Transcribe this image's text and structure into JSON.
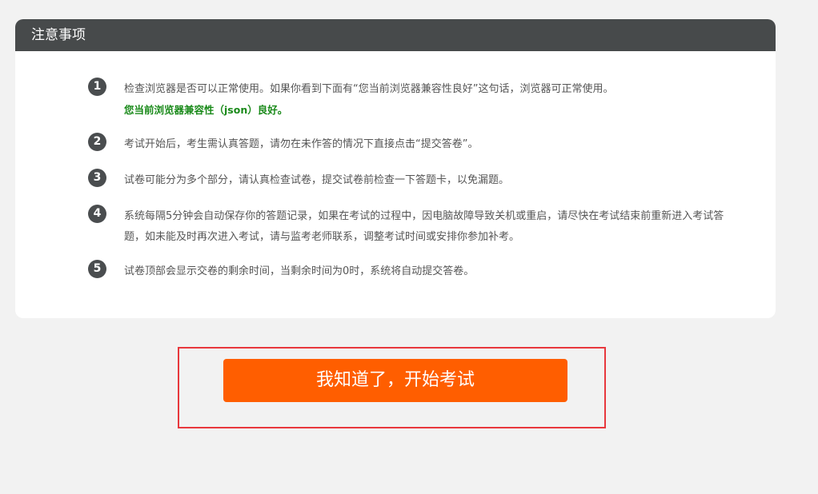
{
  "notice": {
    "title": "注意事项",
    "items": [
      {
        "number": "1",
        "text": "检查浏览器是否可以正常使用。如果你看到下面有“您当前浏览器兼容性良好”这句话，浏览器可正常使用。",
        "compat_text": "您当前浏览器兼容性（json）良好。"
      },
      {
        "number": "2",
        "text": "考试开始后，考生需认真答题，请勿在未作答的情况下直接点击“提交答卷”。"
      },
      {
        "number": "3",
        "text": "试卷可能分为多个部分，请认真检查试卷，提交试卷前检查一下答题卡，以免漏题。"
      },
      {
        "number": "4",
        "text": "系统每隔5分钟会自动保存你的答题记录，如果在考试的过程中，因电脑故障导致关机或重启，请尽快在考试结束前重新进入考试答题，如未能及时再次进入考试，请与监考老师联系，调整考试时间或安排你参加补考。"
      },
      {
        "number": "5",
        "text": "试卷顶部会显示交卷的剩余时间，当剩余时间为0时，系统将自动提交答卷。"
      }
    ]
  },
  "start_button": {
    "label": "我知道了，开始考试"
  },
  "colors": {
    "header_bg": "#474a4b",
    "accent": "#ff5e00",
    "compat_green": "#1a8a1a",
    "highlight_border": "#e8383d"
  }
}
